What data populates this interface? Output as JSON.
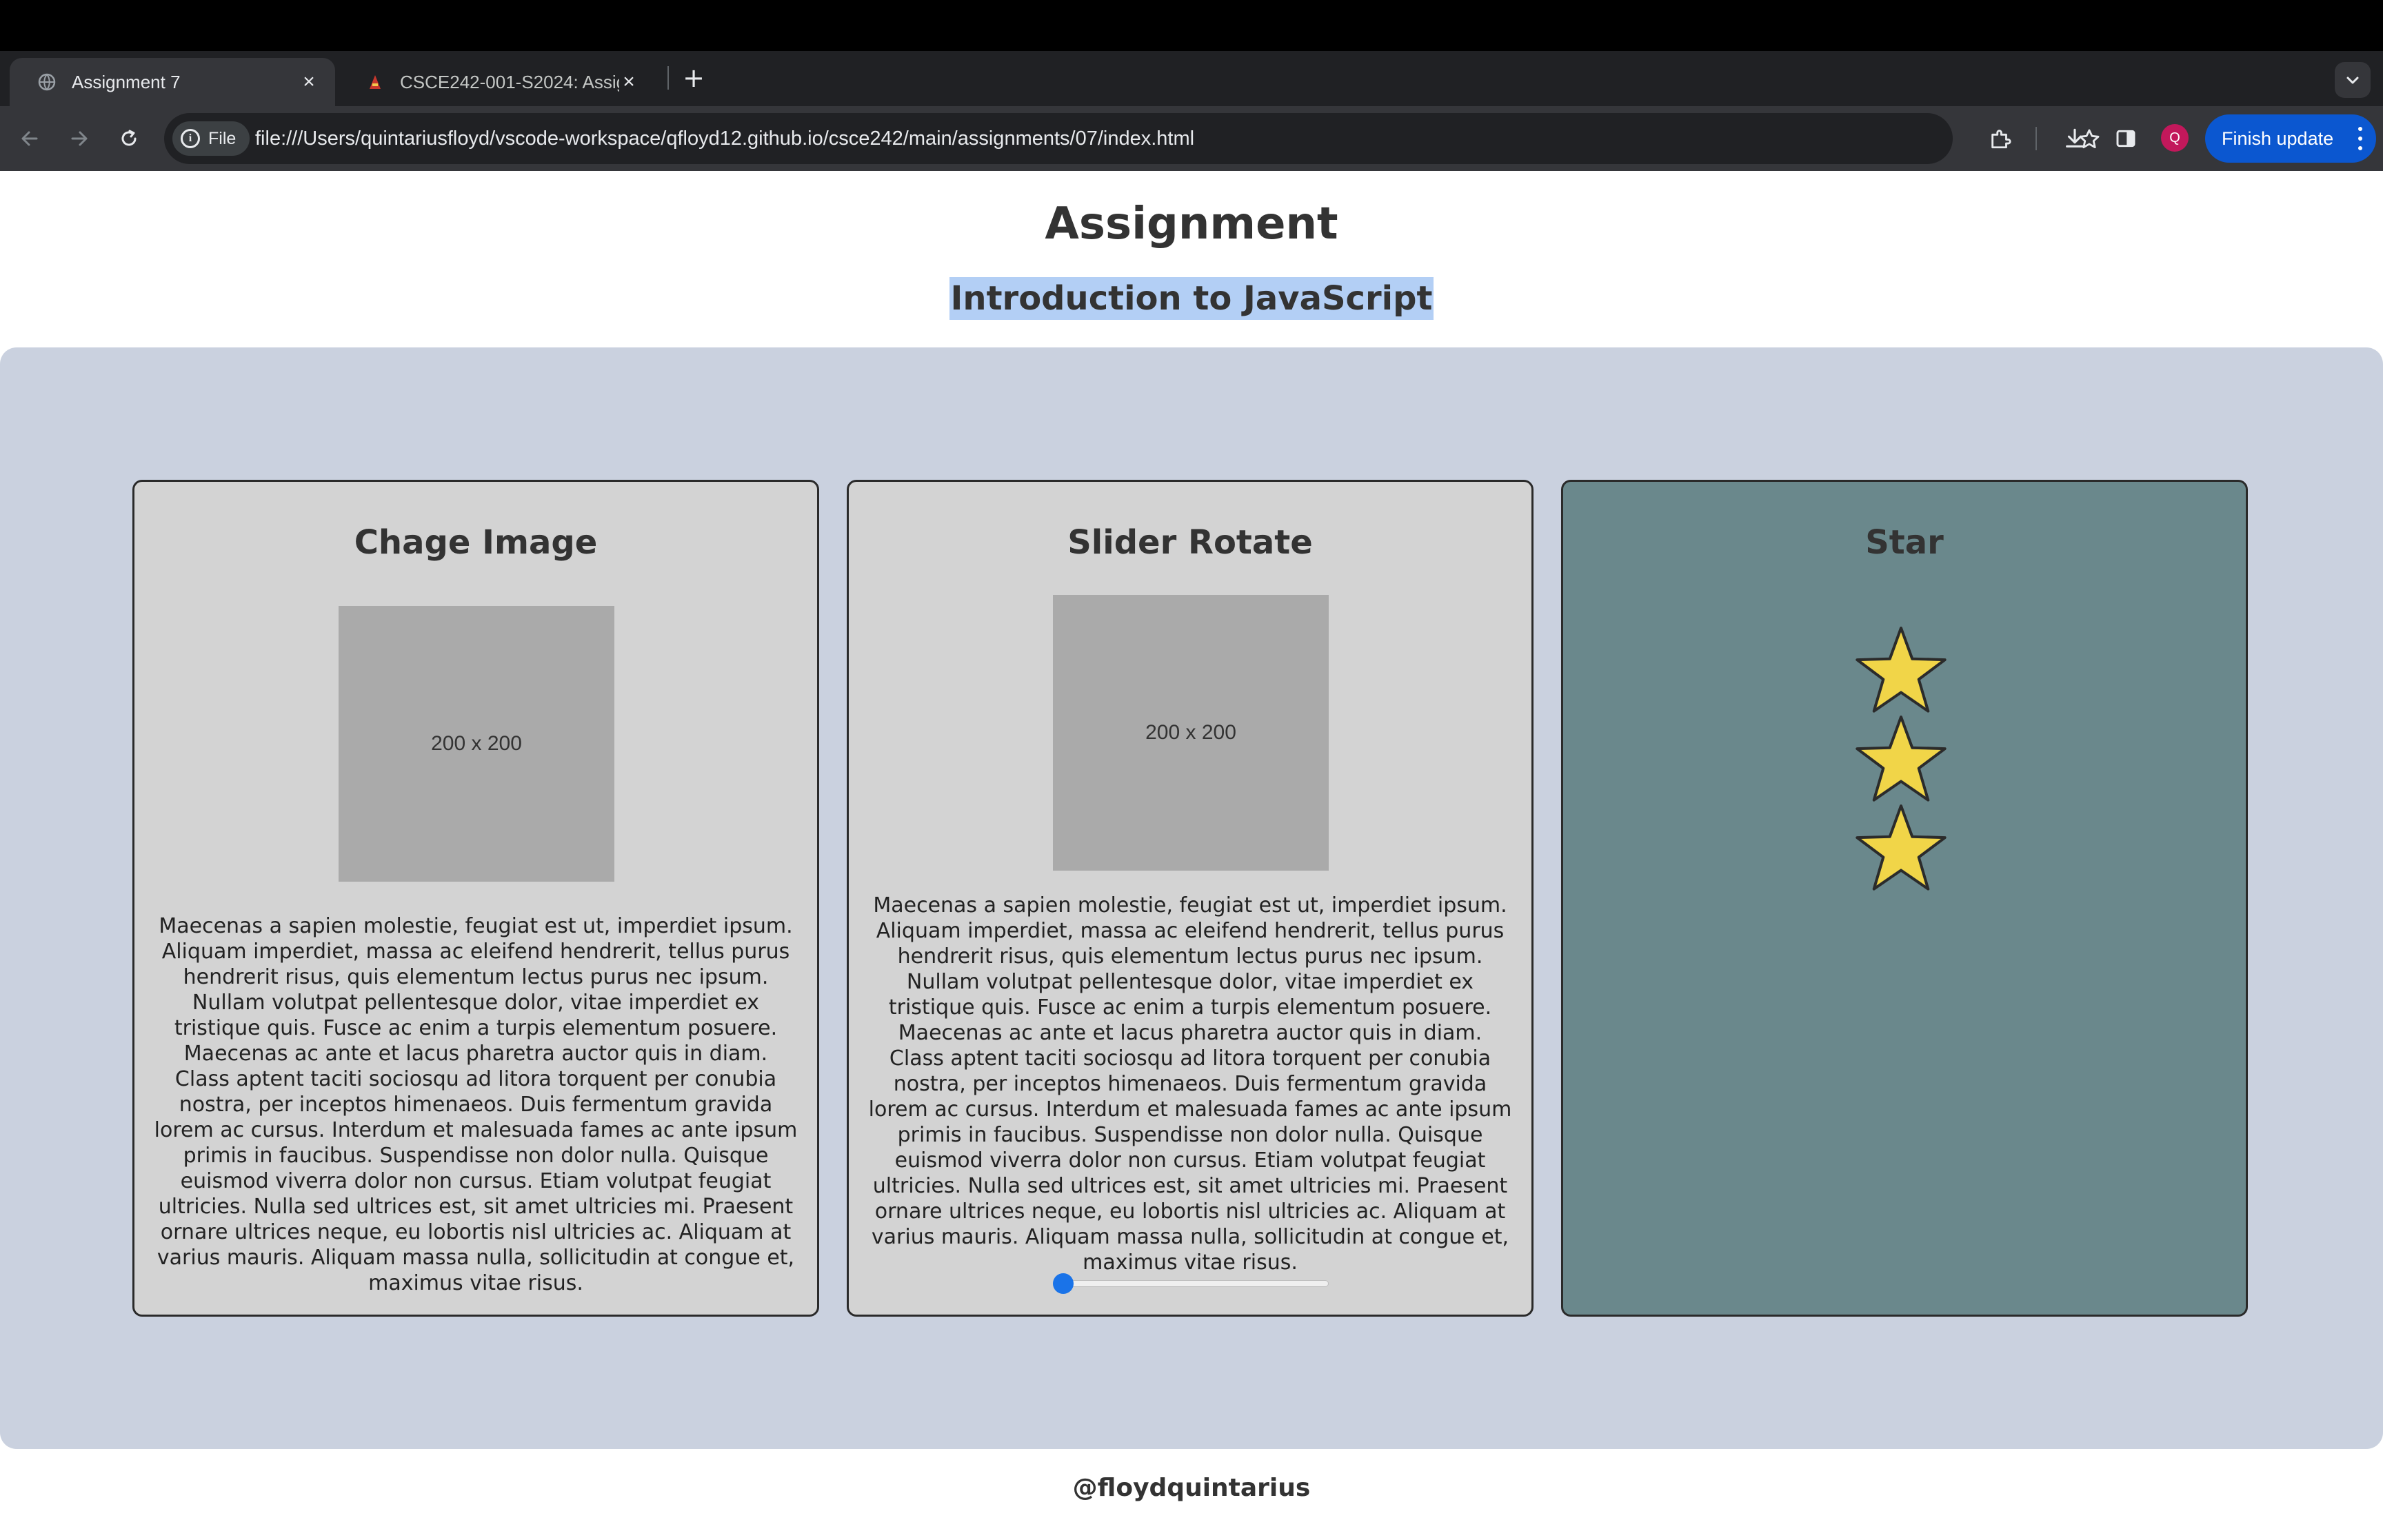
{
  "browser": {
    "tabs": [
      {
        "title": "Assignment 7",
        "active": true
      },
      {
        "title": "CSCE242-001-S2024: Assign",
        "active": false
      }
    ],
    "url_chip": "File",
    "url": "file:///Users/quintariusfloyd/vscode-workspace/qfloyd12.github.io/csce242/main/assignments/07/index.html",
    "avatar_letter": "Q",
    "finish_update_label": "Finish update",
    "icons": [
      "back-icon",
      "forward-icon",
      "reload-icon",
      "info-icon",
      "bookmark-star-icon",
      "extensions-icon",
      "download-icon",
      "side-panel-icon",
      "more-icon",
      "tab-search-icon"
    ],
    "colors": {
      "finish_button": "#0b57d0",
      "avatar": "#c2185b"
    }
  },
  "page": {
    "title": "Assignment",
    "subtitle": "Introduction to JavaScript",
    "footer": "@floydquintarius",
    "colors": {
      "main_background": "#cad1df",
      "card_background": "#d3d3d3",
      "star_card_background": "#6a888c",
      "subtitle_highlight": "#b3cff5",
      "star_fill": "#f1d548"
    }
  },
  "cards": {
    "change_image": {
      "heading": "Chage Image",
      "image_label": "200 x 200",
      "text": "Maecenas a sapien molestie, feugiat est ut, imperdiet ipsum. Aliquam imperdiet, massa ac eleifend hendrerit, tellus purus hendrerit risus, quis elementum lectus purus nec ipsum. Nullam volutpat pellentesque dolor, vitae imperdiet ex tristique quis. Fusce ac enim a turpis elementum posuere. Maecenas ac ante et lacus pharetra auctor quis in diam. Class aptent taciti sociosqu ad litora torquent per conubia nostra, per inceptos himenaeos. Duis fermentum gravida lorem ac cursus. Interdum et malesuada fames ac ante ipsum primis in faucibus. Suspendisse non dolor nulla. Quisque euismod viverra dolor non cursus. Etiam volutpat feugiat ultricies. Nulla sed ultrices est, sit amet ultricies mi. Praesent ornare ultrices neque, eu lobortis nisl ultricies ac. Aliquam at varius mauris. Aliquam massa nulla, sollicitudin at congue et, maximus vitae risus."
    },
    "slider_rotate": {
      "heading": "Slider Rotate",
      "image_label": "200 x 200",
      "text": "Maecenas a sapien molestie, feugiat est ut, imperdiet ipsum. Aliquam imperdiet, massa ac eleifend hendrerit, tellus purus hendrerit risus, quis elementum lectus purus nec ipsum. Nullam volutpat pellentesque dolor, vitae imperdiet ex tristique quis. Fusce ac enim a turpis elementum posuere. Maecenas ac ante et lacus pharetra auctor quis in diam. Class aptent taciti sociosqu ad litora torquent per conubia nostra, per inceptos himenaeos. Duis fermentum gravida lorem ac cursus. Interdum et malesuada fames ac ante ipsum primis in faucibus. Suspendisse non dolor nulla. Quisque euismod viverra dolor non cursus. Etiam volutpat feugiat ultricies. Nulla sed ultrices est, sit amet ultricies mi. Praesent ornare ultrices neque, eu lobortis nisl ultricies ac. Aliquam at varius mauris. Aliquam massa nulla, sollicitudin at congue et, maximus vitae risus.",
      "slider_value_fraction": 0
    },
    "star": {
      "heading": "Star",
      "star_count": 3
    }
  }
}
